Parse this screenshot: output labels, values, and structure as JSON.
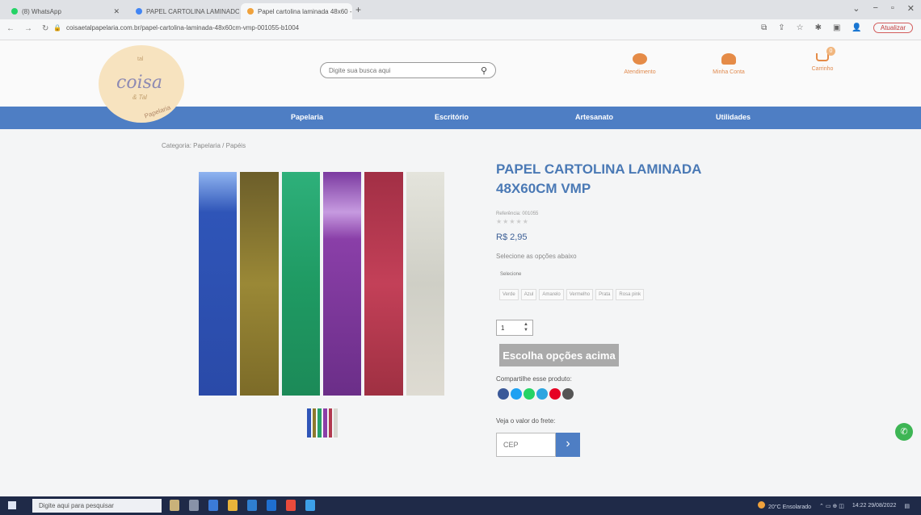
{
  "browser": {
    "tabs": [
      {
        "title": "(8) WhatsApp",
        "favicon_color": "#25d366"
      },
      {
        "title": "PAPEL CARTOLINA LAMINADO -",
        "favicon_color": "#4285f4"
      },
      {
        "title": "Papel cartolina laminada 48x60 -",
        "favicon_color": "#f0a23c"
      }
    ],
    "new_tab": "+",
    "url": "coisaetalpapelaria.com.br/papel-cartolina-laminada-48x60cm-vmp-001055-b1004",
    "update_label": "Atualizar"
  },
  "header": {
    "logo": {
      "top": "tal",
      "main": "coisa",
      "sub": "& Tal",
      "bottom": "Papelaria"
    },
    "search_placeholder": "Digite sua busca aqui",
    "links": [
      {
        "label": "Atendimento",
        "icon": "chat-icon"
      },
      {
        "label": "Minha Conta",
        "icon": "user-icon"
      },
      {
        "label": "Carrinho",
        "icon": "cart-icon",
        "badge": "0"
      }
    ]
  },
  "nav": {
    "items": [
      "Papelaria",
      "Escritório",
      "Artesanato",
      "Utilidades"
    ]
  },
  "breadcrumb": "Categoria: Papelaria / Papéis",
  "product": {
    "title": "PAPEL CARTOLINA LAMINADA 48X60CM VMP",
    "reference": "Referência: 001055",
    "rating_stars": "★★★★★",
    "price": "R$ 2,95",
    "select_options_text": "Selecione as opções abaixo",
    "select_label": "Selecione",
    "colors": [
      "Verde",
      "Azul",
      "Amarelo",
      "Vermelho",
      "Prata",
      "Rosa pink"
    ],
    "quantity": "1",
    "choose_button": "Escolha opções acima",
    "share_label": "Compartilhe esse produto:",
    "share_icons": [
      {
        "name": "facebook-icon",
        "color": "#3b5998"
      },
      {
        "name": "twitter-icon",
        "color": "#1da1f2"
      },
      {
        "name": "whatsapp-icon",
        "color": "#25d366"
      },
      {
        "name": "telegram-icon",
        "color": "#2ca5e0"
      },
      {
        "name": "pinterest-icon",
        "color": "#e60023"
      },
      {
        "name": "email-icon",
        "color": "#555555"
      }
    ],
    "freight_label": "Veja o valor do frete:",
    "cep_placeholder": "CEP",
    "image_strip_colors": [
      "#2f55b8",
      "#8d7a2e",
      "#27a06a",
      "#8a3fa8",
      "#b23a4f",
      "#d8d8d0"
    ]
  },
  "taskbar": {
    "search_placeholder": "Digite aqui para pesquisar",
    "weather": "20°C Ensolarado",
    "time": "14:22",
    "date": "29/08/2022"
  }
}
